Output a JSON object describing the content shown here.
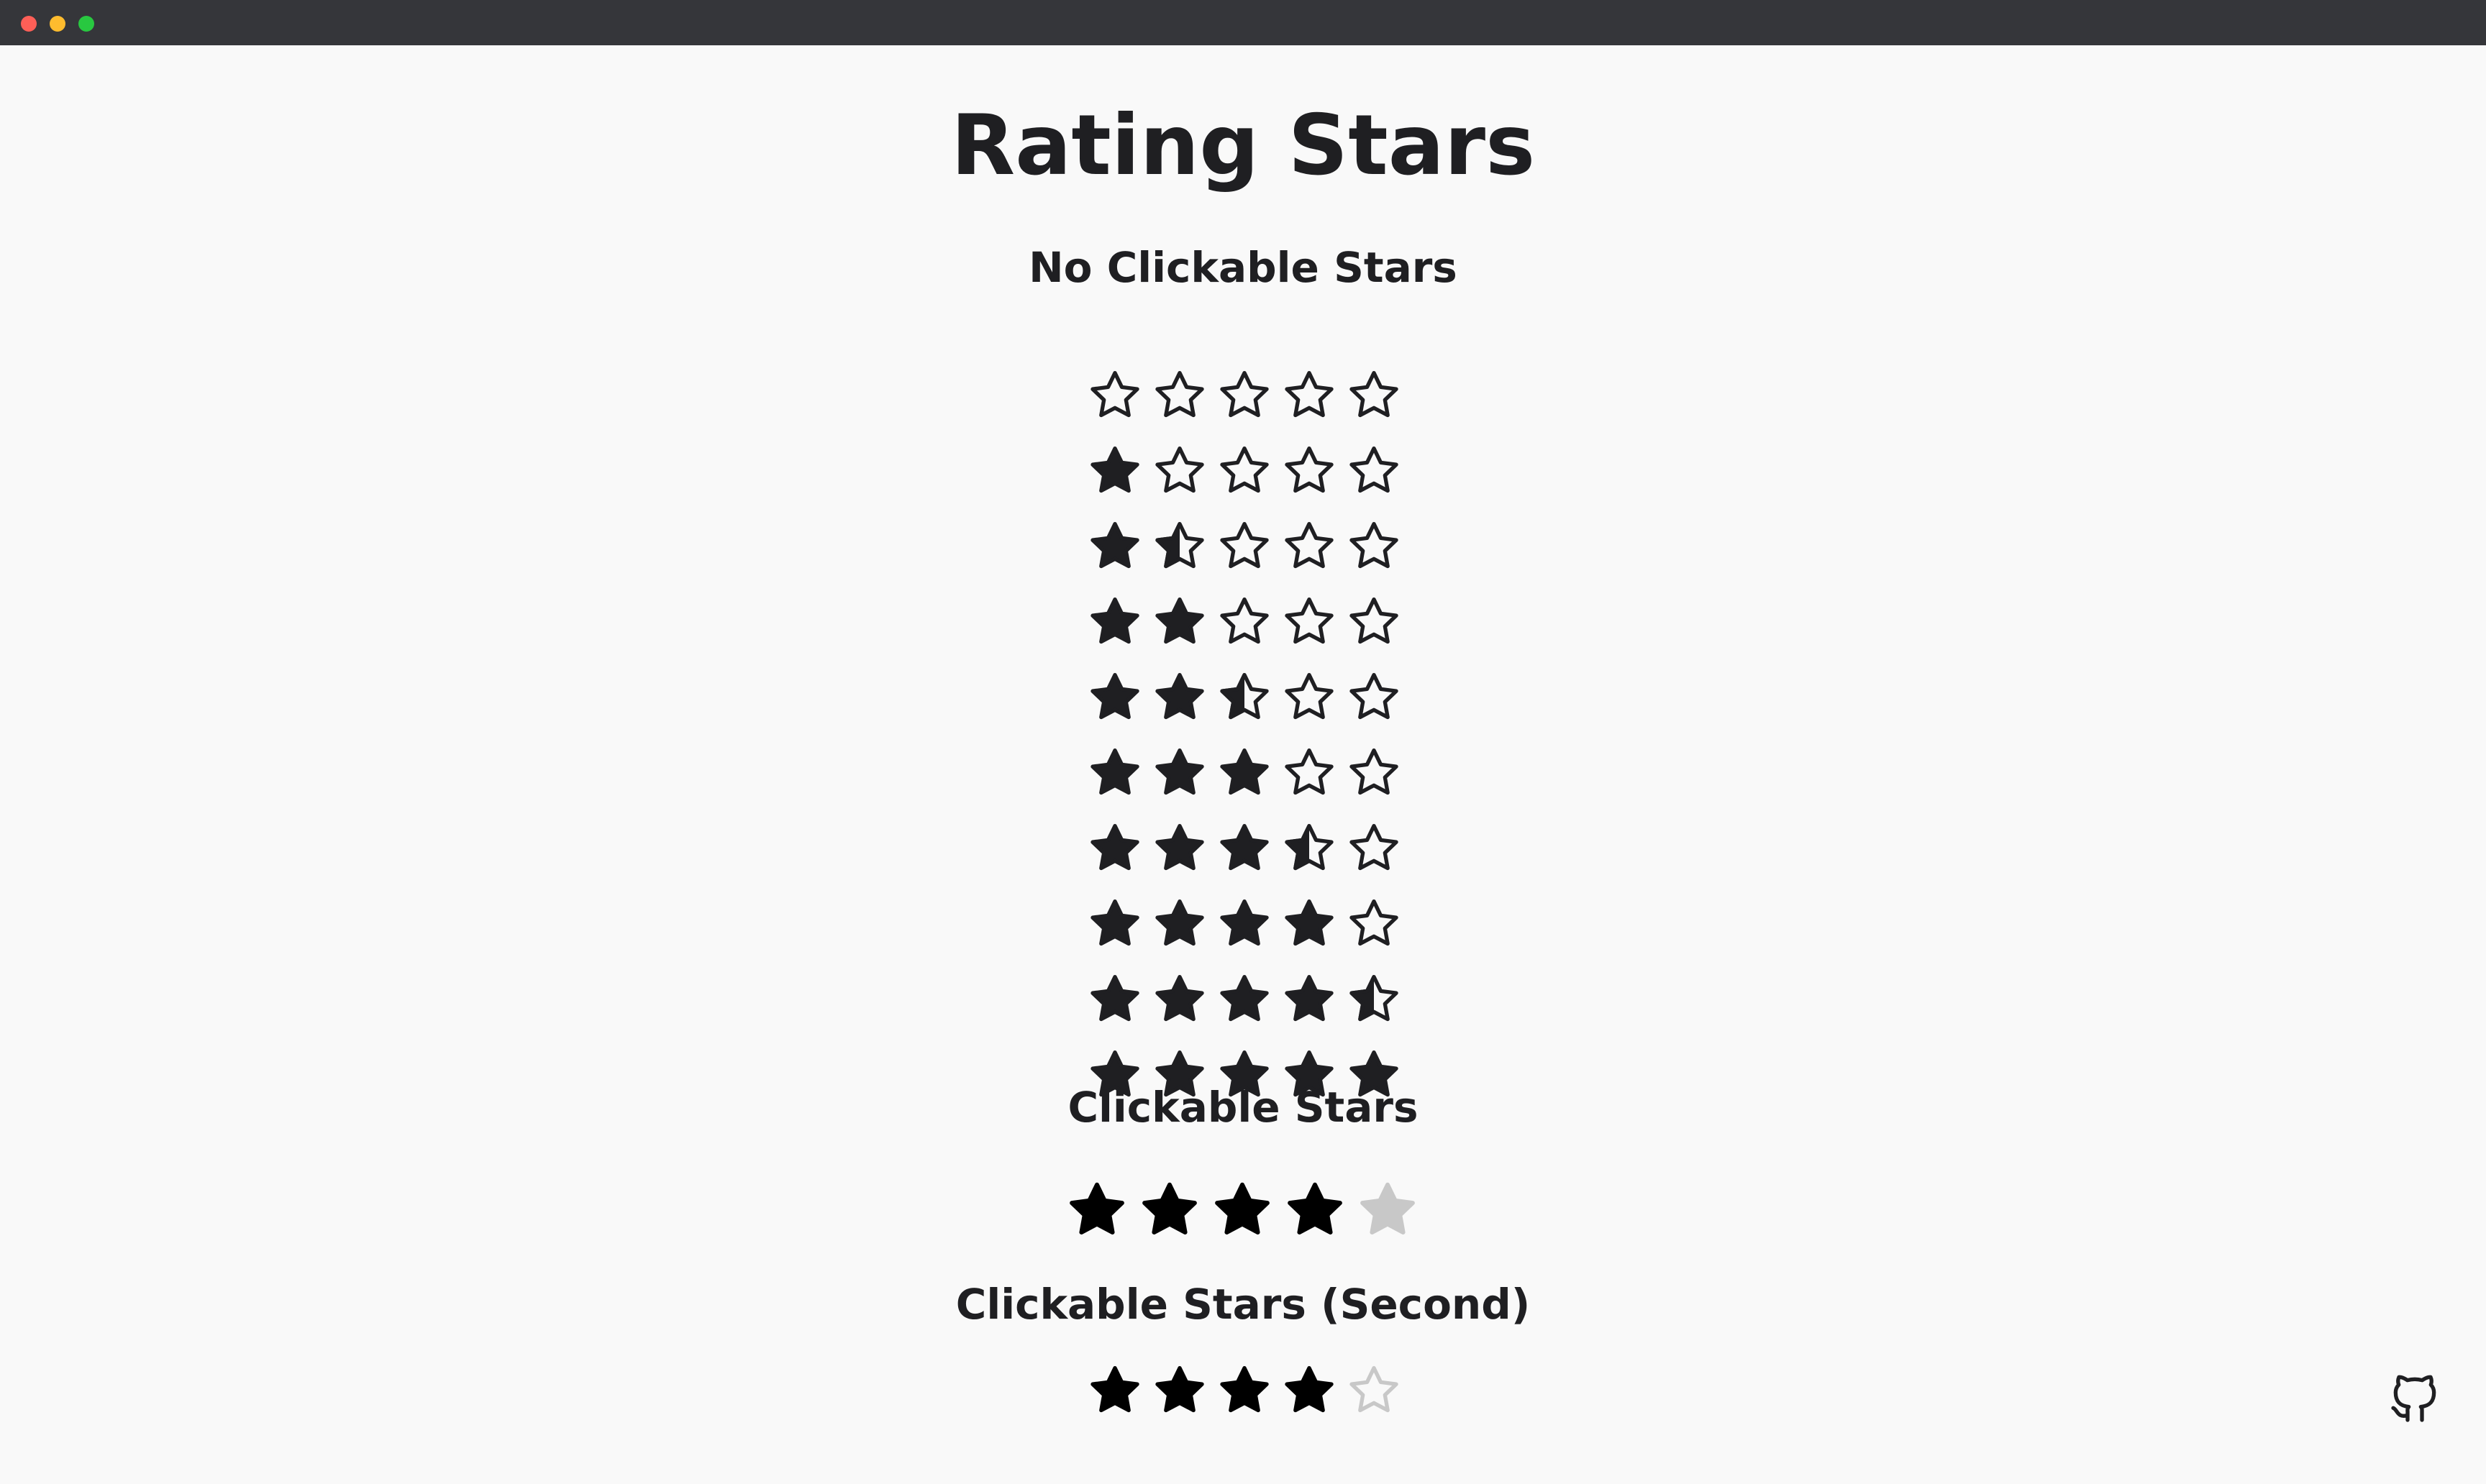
{
  "title": "Rating Stars",
  "sections": {
    "static": "No Clickable Stars",
    "clickable": "Clickable Stars",
    "clickable_second": "Clickable Stars (Second)"
  },
  "static_ratings": [
    0,
    1,
    1.5,
    2,
    2.5,
    3,
    3.5,
    4,
    4.5,
    5
  ],
  "clickable_rating": 4,
  "clickable_second_rating": 4,
  "max_stars": 5,
  "colors": {
    "star": "#1f1f22",
    "clickable_on": "#000000",
    "clickable_off": "#c8c8c8",
    "second_off_outline": "#c8c8c8"
  },
  "icons": {
    "github": "github-icon"
  }
}
